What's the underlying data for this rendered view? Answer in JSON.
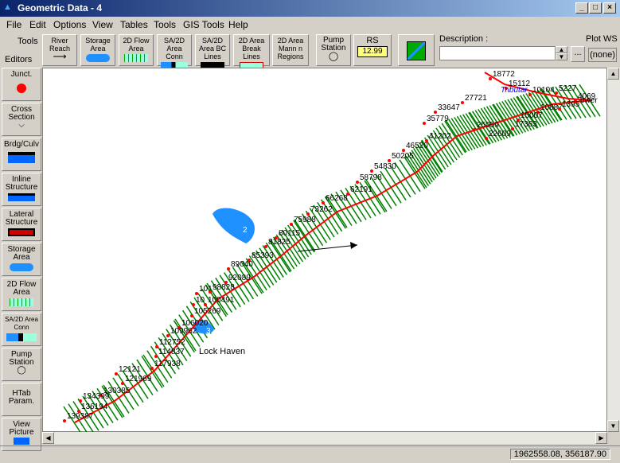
{
  "window": {
    "title": "Geometric Data - 4"
  },
  "menu": [
    "File",
    "Edit",
    "Options",
    "View",
    "Tables",
    "Tools",
    "GIS Tools",
    "Help"
  ],
  "toolbar": {
    "tools_label": "Tools",
    "editors_label": "Editors",
    "river_reach": "River Reach",
    "storage_area": "Storage Area",
    "flow_area_2d": "2D Flow Area",
    "sa_2d_conn": "SA/2D Area Conn",
    "sa_2d_bc": "SA/2D Area BC Lines",
    "breaklines": "2D Area Break Lines",
    "mann_n": "2D Area Mann n Regions",
    "pump_station": "Pump Station",
    "rs_label": "RS",
    "rs_value": "12.99",
    "description_label": "Description :",
    "plot_ws_label": "Plot WS",
    "plot_ws_value": "(none)",
    "ellipsis": "..."
  },
  "sidebar": [
    {
      "label": "Junct."
    },
    {
      "label": "Cross Section"
    },
    {
      "label": "Brdg/Culv"
    },
    {
      "label": "Inline Structure"
    },
    {
      "label": "Lateral Structure"
    },
    {
      "label": "Storage Area"
    },
    {
      "label": "2D Flow Area"
    },
    {
      "label": "SA/2D Area Conn"
    },
    {
      "label": "Pump Station"
    },
    {
      "label": "HTab Param."
    },
    {
      "label": "View Picture"
    }
  ],
  "map": {
    "stations": [
      "18772",
      "15112",
      "10104",
      "5227",
      "4069",
      "27721",
      "33647",
      "10687",
      "1395",
      "35779",
      "15007",
      "25059",
      "17363",
      "22609",
      "41202",
      "46520",
      "50205",
      "54830",
      "58798",
      "62191",
      "66268",
      "73262",
      "75988",
      "80115",
      "81825",
      "85393",
      "89040",
      "92089",
      "101",
      "98828",
      "10",
      "100491",
      "105269",
      "106020",
      "109962",
      "112752",
      "114837",
      "117938",
      "12121",
      "121969",
      "130385",
      "134399",
      "136194",
      "139387"
    ],
    "place_label": "Lock Haven",
    "storage_ids": [
      "2",
      "3"
    ],
    "river_label": "Tributar",
    "river_label2": "ower"
  },
  "status": {
    "coords": "1962558.08, 356187.90"
  },
  "colors": {
    "river": "#ff0000",
    "xs": "#008000",
    "storage": "#1e90ff",
    "title_start": "#0a246a",
    "title_end": "#a6caf0"
  }
}
